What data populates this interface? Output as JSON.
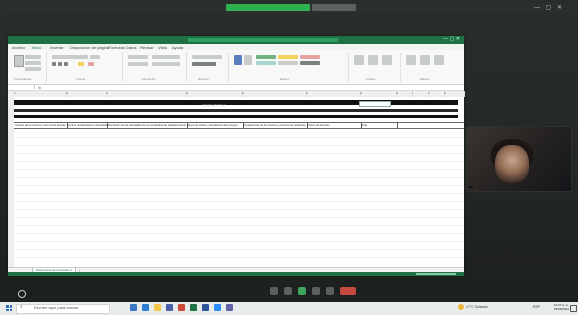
{
  "meeting": {
    "window_controls": "— ▢ ✕"
  },
  "excel": {
    "window_controls": "— ▢ ✕",
    "ribbon_tabs": [
      "Archivo",
      "Inicio",
      "Insertar",
      "Disposición de página",
      "Fórmulas",
      "Datos",
      "Revisar",
      "Vista",
      "Ayuda"
    ],
    "active_tab": "Inicio",
    "ribbon_groups": [
      "Portapapeles",
      "Fuente",
      "Alineación",
      "Número",
      "Estilos",
      "Celdas",
      "Edición"
    ],
    "name_box": "",
    "fx": "fx",
    "columns": [
      "A",
      "B",
      "C",
      "D",
      "E",
      "F",
      "G",
      "H",
      "I",
      "J",
      "K"
    ],
    "sheet_heading": "RESPUESTAS",
    "date_cell": "",
    "table_headers": [
      "Nombre de la empresa o del Centro Escolar",
      "Nombre del Estudiante o Estudiantes",
      "Descripción de las actividades de los empleados del establecimiento",
      "Banco de ofertas y Estudiantes del proyecto",
      "Competencias de la empresa y proyecto de residencia",
      "Criterio de Atención",
      "Otras"
    ],
    "sheet_tab": "Respuestas de formulario 1",
    "add_sheet": "+"
  },
  "participant": {
    "name": ""
  },
  "taskbar": {
    "search_placeholder": "Escribe aquí para buscar",
    "weather": "17°C Soleado",
    "tray_lang": "ESP",
    "clock_time": "10:37 a. m.",
    "clock_date": "29/09/2022"
  },
  "colors": {
    "excel_green": "#1e7145",
    "meeting_active": "#2fb24d",
    "end_call": "#c64a3f"
  }
}
